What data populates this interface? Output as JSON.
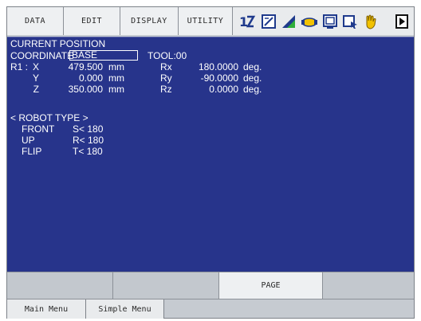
{
  "menu": {
    "data": "DATA",
    "edit": "EDIT",
    "display": "DISPLAY",
    "utility": "UTILITY"
  },
  "status_icons": [
    "step-number-icon",
    "edit-sheet-icon",
    "signal-chart-icon",
    "handshake-icon",
    "display-icon",
    "cursor-window-icon",
    "hand-icon",
    "play-icon"
  ],
  "screen": {
    "title": "CURRENT POSITION",
    "coordinate_label": "COORDINATE",
    "coordinate_value": "BASE",
    "tool": "TOOL:00",
    "group": "R1 :",
    "rows": [
      {
        "axis": "X",
        "value": "479.500",
        "unit": "mm",
        "raxis": "Rx",
        "rvalue": "180.0000",
        "runit": "deg."
      },
      {
        "axis": "Y",
        "value": "0.000",
        "unit": "mm",
        "raxis": "Ry",
        "rvalue": "-90.0000",
        "runit": "deg."
      },
      {
        "axis": "Z",
        "value": "350.000",
        "unit": "mm",
        "raxis": "Rz",
        "rvalue": "0.0000",
        "runit": "deg."
      }
    ],
    "robot_type_header": "< ROBOT TYPE >",
    "robot_type": [
      {
        "label": "FRONT",
        "value": "S< 180"
      },
      {
        "label": "UP",
        "value": "R< 180"
      },
      {
        "label": "FLIP",
        "value": "T< 180"
      }
    ]
  },
  "fkeys": [
    "",
    "",
    "PAGE",
    ""
  ],
  "bottom_menu": {
    "main": "Main Menu",
    "simple": "Simple Menu"
  },
  "colors": {
    "panel": "#27348b",
    "chrome": "#c6cbd1",
    "tab": "#eef0f2"
  }
}
